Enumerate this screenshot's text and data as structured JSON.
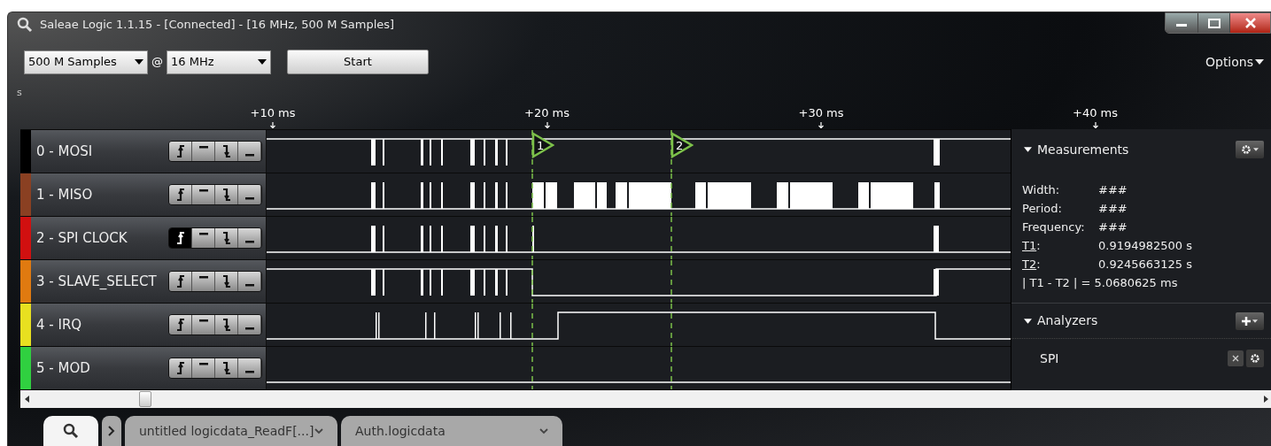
{
  "window": {
    "title": "Saleae Logic 1.1.15 - [Connected] - [16 MHz, 500 M Samples]"
  },
  "toolbar": {
    "samples": "500 M Samples",
    "at": "@",
    "rate": "16 MHz",
    "start_button": "Start",
    "options": "Options"
  },
  "units_label": "s",
  "ruler": {
    "ticks": [
      "+10 ms",
      "+20 ms",
      "+30 ms",
      "+40 ms"
    ]
  },
  "markers": [
    {
      "label": "1"
    },
    {
      "label": "2"
    }
  ],
  "channels": [
    {
      "name": "0 - MOSI",
      "color": "#000000",
      "triggers": [
        {
          "kind": "rising",
          "selected": false
        },
        {
          "kind": "high",
          "selected": false
        },
        {
          "kind": "falling",
          "selected": false
        },
        {
          "kind": "low",
          "selected": false
        }
      ]
    },
    {
      "name": "1 - MISO",
      "color": "#8a4022",
      "triggers": [
        {
          "kind": "rising",
          "selected": false
        },
        {
          "kind": "high",
          "selected": false
        },
        {
          "kind": "falling",
          "selected": false
        },
        {
          "kind": "low",
          "selected": false
        }
      ]
    },
    {
      "name": "2 - SPI CLOCK",
      "color": "#d11010",
      "triggers": [
        {
          "kind": "rising",
          "selected": true
        },
        {
          "kind": "high",
          "selected": false
        },
        {
          "kind": "falling",
          "selected": false
        },
        {
          "kind": "low",
          "selected": false
        }
      ]
    },
    {
      "name": "3 - SLAVE_SELECT",
      "color": "#e07a10",
      "triggers": [
        {
          "kind": "rising",
          "selected": false
        },
        {
          "kind": "high",
          "selected": false
        },
        {
          "kind": "falling",
          "selected": false
        },
        {
          "kind": "low",
          "selected": false
        }
      ]
    },
    {
      "name": "4 - IRQ",
      "color": "#e8e020",
      "triggers": [
        {
          "kind": "rising",
          "selected": false
        },
        {
          "kind": "high",
          "selected": false
        },
        {
          "kind": "falling",
          "selected": false
        },
        {
          "kind": "low",
          "selected": false
        }
      ]
    },
    {
      "name": "5 - MOD",
      "color": "#30d040",
      "triggers": [
        {
          "kind": "rising",
          "selected": false
        },
        {
          "kind": "high",
          "selected": false
        },
        {
          "kind": "falling",
          "selected": false
        },
        {
          "kind": "low",
          "selected": false
        }
      ]
    }
  ],
  "measurements": {
    "title": "Measurements",
    "rows": [
      {
        "label": "Width:",
        "underlined": false,
        "value": "###"
      },
      {
        "label": "Period:",
        "underlined": false,
        "value": "###"
      },
      {
        "label": "Frequency:",
        "underlined": false,
        "value": "###"
      },
      {
        "label": "T1",
        "underlined": true,
        "separator": ":",
        "value": "0.9194982500 s"
      },
      {
        "label": "T2",
        "underlined": true,
        "separator": ":",
        "value": "0.9245663125 s"
      }
    ],
    "summary": "| T1 - T2 | = 5.0680625 ms"
  },
  "analyzers": {
    "title": "Analyzers",
    "items": [
      {
        "name": "SPI"
      }
    ]
  },
  "tabs": [
    {
      "kind": "search",
      "selected": true
    },
    {
      "kind": "expand",
      "selected": false
    },
    {
      "kind": "file",
      "label": "untitled logicdata_ReadF[...]",
      "selected": false
    },
    {
      "kind": "file",
      "label": "Auth.logicdata",
      "selected": false
    }
  ]
}
